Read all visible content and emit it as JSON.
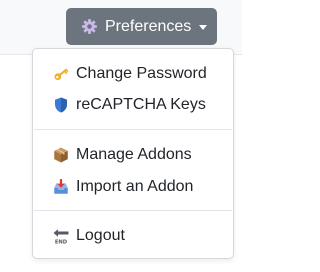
{
  "toolbar": {
    "preferences_label": "Preferences",
    "button_color": "#6c757d"
  },
  "menu": {
    "groups": [
      [
        {
          "label": "Change Password",
          "icon": "key-icon"
        },
        {
          "label": "reCAPTCHA Keys",
          "icon": "shield-icon"
        }
      ],
      [
        {
          "label": "Manage Addons",
          "icon": "package-icon"
        },
        {
          "label": "Import an Addon",
          "icon": "inbox-tray-icon"
        }
      ],
      [
        {
          "label": "Logout",
          "icon": "end-arrow-icon"
        }
      ]
    ]
  }
}
